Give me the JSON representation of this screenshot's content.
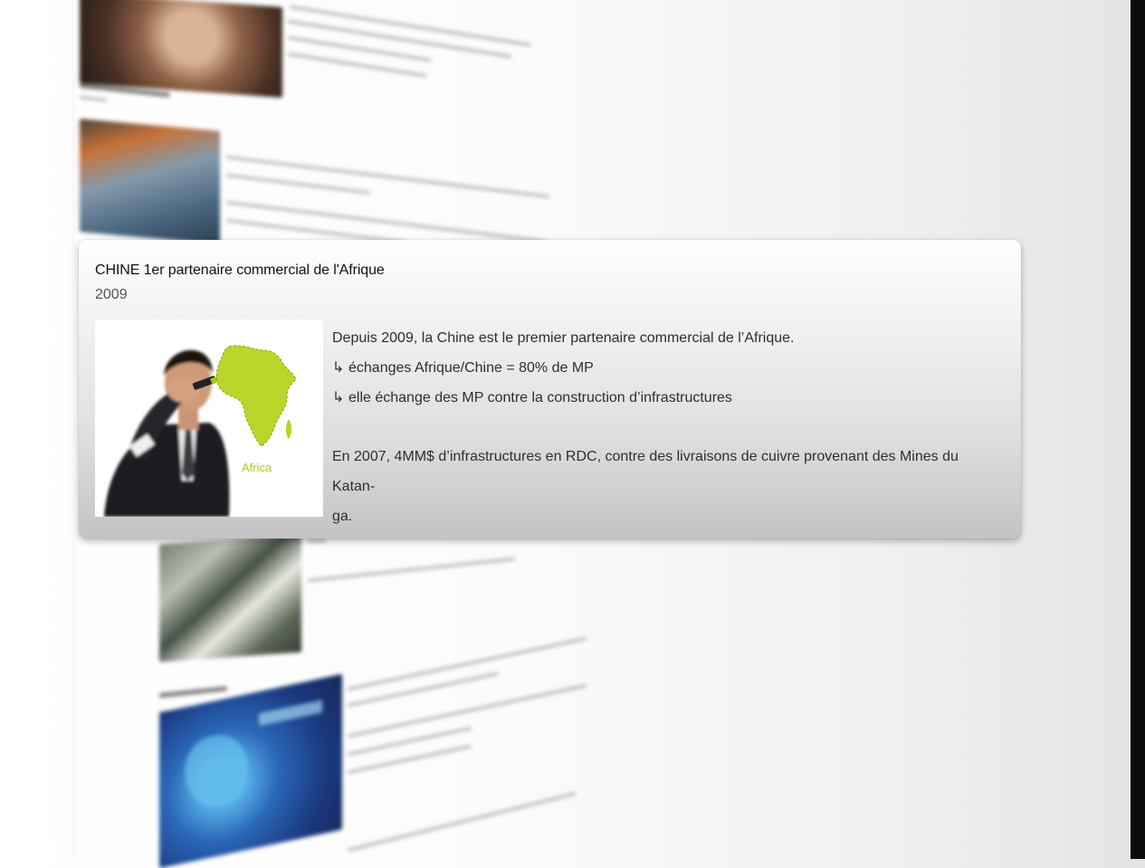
{
  "card": {
    "title": "CHINE 1er partenaire commercial de l'Afrique",
    "year": "2009",
    "image_label": "Africa",
    "paragraph1": "Depuis 2009, la Chine est le premier partenaire commercial de l’Afrique.",
    "bullets": [
      {
        "arrow": "↳",
        "text": "échanges Afrique/Chine = 80% de MP"
      },
      {
        "arrow": "↳",
        "text": "elle échange des MP contre la construction d’infrastructures"
      }
    ],
    "paragraph2_line1": "En 2007, 4MM$ d’infrastructures en RDC, contre des livraisons de cuivre provenant des Mines du Katan-",
    "paragraph2_line2": "ga."
  },
  "colors": {
    "card_top": "#ffffff",
    "card_bottom": "#c3c3c3",
    "africa_green": "#b5d51f",
    "suit": "#1f1f22"
  },
  "icons": {
    "bullet_arrow": "arrow-down-right-icon"
  }
}
